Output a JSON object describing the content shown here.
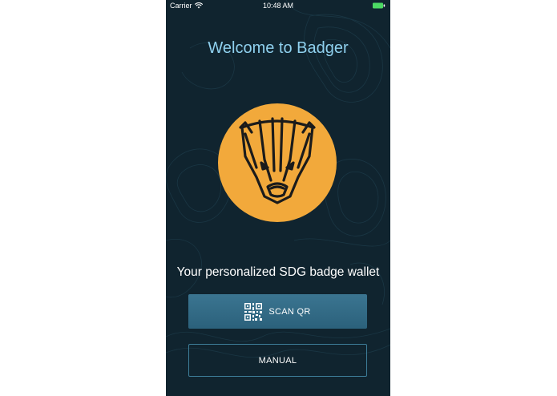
{
  "status_bar": {
    "carrier": "Carrier",
    "time": "10:48 AM"
  },
  "welcome": {
    "title": "Welcome to Badger",
    "tagline": "Your personalized SDG badge wallet"
  },
  "actions": {
    "scan_label": "SCAN QR",
    "manual_label": "MANUAL"
  },
  "colors": {
    "background": "#10242f",
    "title": "#8fd0ee",
    "logo_circle": "#f2a93b",
    "scan_button": "#33708a"
  },
  "icons": {
    "logo": "badger-logo-icon",
    "scan": "qr-code-icon",
    "wifi": "wifi-icon",
    "battery": "battery-icon"
  }
}
